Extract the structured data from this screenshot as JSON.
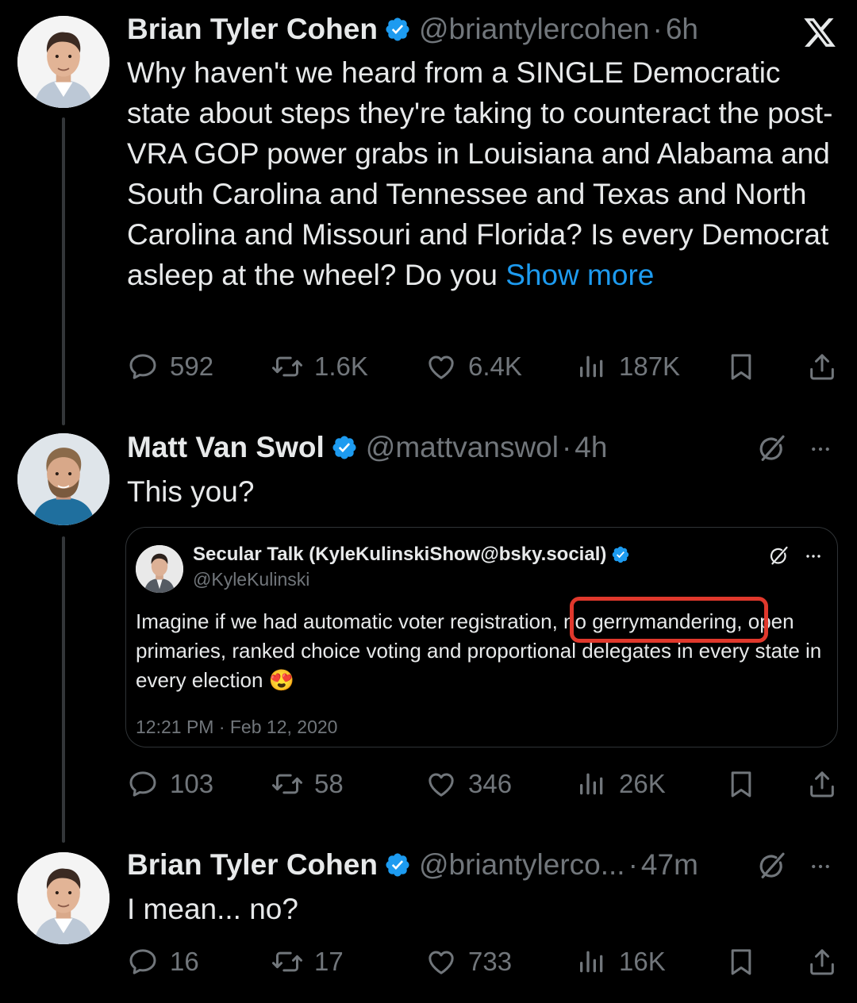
{
  "app": {
    "logo": "x-logo-icon"
  },
  "tweets": [
    {
      "name": "Brian Tyler Cohen",
      "handle": "@briantylercohen",
      "time": "6h",
      "text": "Why haven't we heard from a SINGLE Democratic state about steps they're taking to counteract the post-VRA GOP power grabs in Louisiana and Alabama and South Carolina and Tennessee and Texas and North Carolina and Missouri and Florida? Is every Democrat asleep at the wheel? Do you",
      "show_more": "Show more",
      "replies": "592",
      "reposts": "1.6K",
      "likes": "6.4K",
      "views": "187K"
    },
    {
      "name": "Matt Van Swol",
      "handle": "@mattvanswol",
      "time": "4h",
      "text": "This you?",
      "replies": "103",
      "reposts": "58",
      "likes": "346",
      "views": "26K",
      "quote": {
        "name": "Secular Talk (KyleKulinskiShow@bsky.social)",
        "handle": "@KyleKulinski",
        "text_part1": "Imagine if we had automatic voter registration, ",
        "text_highlight": "no gerrymandering,",
        "text_part2": " open primaries, ranked choice voting and proportional delegates in every state in every election",
        "emoji": "😍",
        "timestamp": "12:21 PM · Feb 12, 2020"
      }
    },
    {
      "name": "Brian Tyler Cohen",
      "handle": "@briantylerco...",
      "time": "47m",
      "text": "I mean... no?",
      "replies": "16",
      "reposts": "17",
      "likes": "733",
      "views": "16K"
    }
  ],
  "dot": "·",
  "colors": {
    "accent": "#1d9bf0",
    "muted": "#71767b",
    "highlight_box": "#e0382c"
  }
}
